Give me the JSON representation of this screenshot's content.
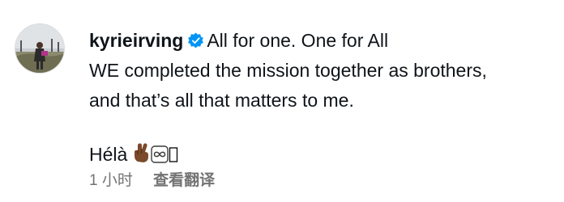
{
  "comment": {
    "username": "kyrieirving",
    "verified": true,
    "caption_line1": "All for one. One for All",
    "caption_line2": "WE completed the mission together as brothers,",
    "caption_line3": "and that’s all that matters to me.",
    "signoff": "Hélà",
    "emojis": [
      "crossed-fingers-icon",
      "infinity-icon",
      "missing-glyph-box"
    ],
    "time": "1 小时",
    "translate_label": "查看翻译"
  },
  "colors": {
    "text": "#0f1419",
    "secondary": "#737373",
    "verified_badge": "#0095f6",
    "avatar_border": "#dbdbdb"
  }
}
